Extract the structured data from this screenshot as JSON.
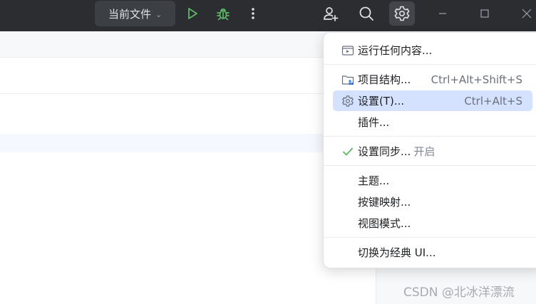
{
  "toolbar": {
    "run_config_label": "当前文件",
    "icons": [
      "chevron-down-icon",
      "run-icon",
      "debug-icon",
      "more-vertical-icon",
      "add-user-icon",
      "search-icon",
      "gear-icon",
      "minimize-icon",
      "maximize-icon",
      "close-icon"
    ]
  },
  "menu": {
    "items": [
      {
        "label": "运行任何内容...",
        "shortcut": "",
        "icon": "run-anything-icon"
      },
      {
        "label": "项目结构...",
        "shortcut": "Ctrl+Alt+Shift+S",
        "icon": "project-structure-icon"
      },
      {
        "label": "设置(T)...",
        "shortcut": "Ctrl+Alt+S",
        "icon": "gear-icon",
        "selected": true
      },
      {
        "label": "插件...",
        "shortcut": ""
      },
      {
        "label": "设置同步...",
        "suffix": "开启",
        "icon": "checkmark-icon"
      },
      {
        "label": "主题...",
        "shortcut": ""
      },
      {
        "label": "按键映射...",
        "shortcut": ""
      },
      {
        "label": "视图模式...",
        "shortcut": ""
      },
      {
        "label": "切换为经典 UI...",
        "shortcut": ""
      }
    ]
  },
  "watermark": "CSDN @北冰洋漂流",
  "colors": {
    "toolbar_bg": "#2b2d30",
    "run_green": "#5fb865",
    "selection": "#d4e2ff",
    "check_green": "#5fb865",
    "accent_blue": "#3574f0"
  }
}
